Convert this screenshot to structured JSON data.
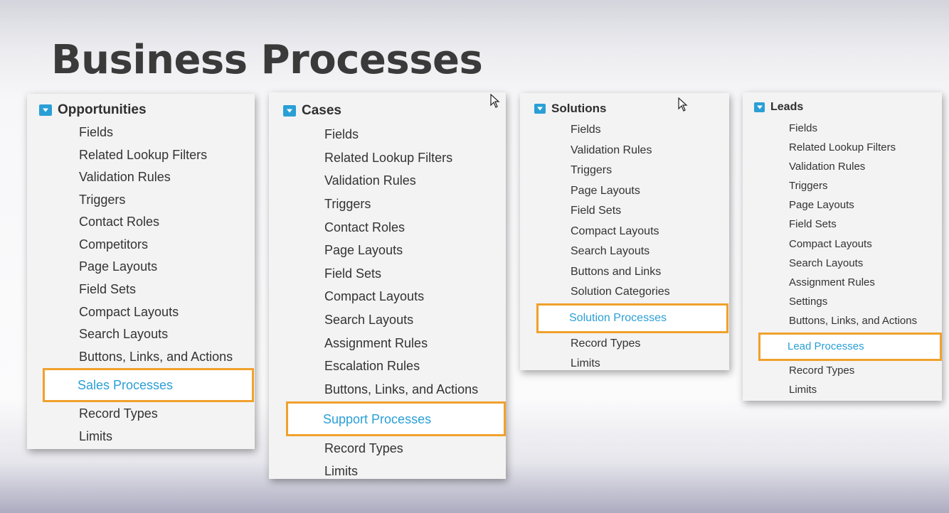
{
  "page": {
    "title": "Business Processes"
  },
  "panels": {
    "opportunities": {
      "header": "Opportunities",
      "items": [
        "Fields",
        "Related Lookup Filters",
        "Validation Rules",
        "Triggers",
        "Contact Roles",
        "Competitors",
        "Page Layouts",
        "Field Sets",
        "Compact Layouts",
        "Search Layouts",
        "Buttons, Links, and Actions",
        "Sales Processes",
        "Record Types",
        "Limits"
      ],
      "highlighted": "Sales Processes"
    },
    "cases": {
      "header": "Cases",
      "items": [
        "Fields",
        "Related Lookup Filters",
        "Validation Rules",
        "Triggers",
        "Contact Roles",
        "Page Layouts",
        "Field Sets",
        "Compact Layouts",
        "Search Layouts",
        "Assignment Rules",
        "Escalation Rules",
        "Buttons, Links, and Actions",
        "Support Processes",
        "Record Types",
        "Limits"
      ],
      "highlighted": "Support Processes"
    },
    "solutions": {
      "header": "Solutions",
      "items": [
        "Fields",
        "Validation Rules",
        "Triggers",
        "Page Layouts",
        "Field Sets",
        "Compact Layouts",
        "Search Layouts",
        "Buttons and Links",
        "Solution Categories",
        "Solution Processes",
        "Record Types",
        "Limits"
      ],
      "highlighted": "Solution Processes"
    },
    "leads": {
      "header": "Leads",
      "items": [
        "Fields",
        "Related Lookup Filters",
        "Validation Rules",
        "Triggers",
        "Page Layouts",
        "Field Sets",
        "Compact Layouts",
        "Search Layouts",
        "Assignment Rules",
        "Settings",
        "Buttons, Links, and Actions",
        "Lead Processes",
        "Record Types",
        "Limits"
      ],
      "highlighted": "Lead Processes"
    }
  },
  "colors": {
    "accent": "#2a9fd6",
    "highlight_border": "#f0a12c",
    "text": "#333333"
  },
  "icons": {
    "toggle": "collapse-triangle-icon",
    "cursor": "mouse-pointer-icon"
  }
}
